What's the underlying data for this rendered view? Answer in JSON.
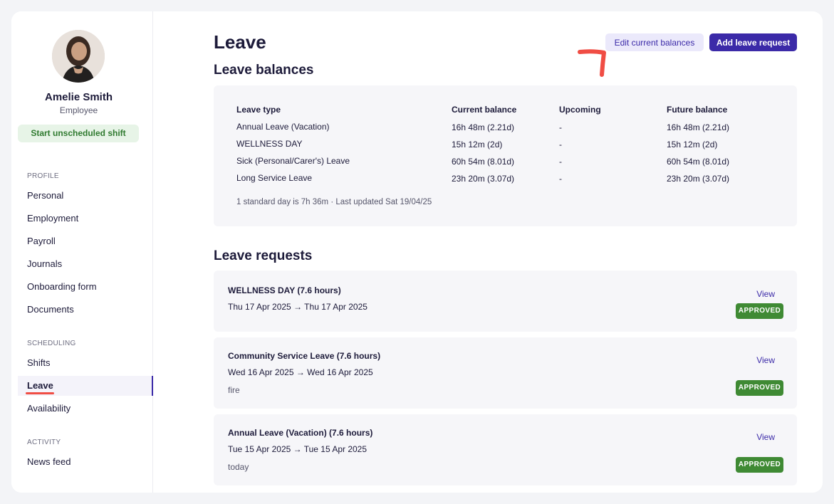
{
  "user": {
    "name": "Amelie Smith",
    "role": "Employee",
    "shift_button": "Start unscheduled shift"
  },
  "sidebar": {
    "sections": [
      {
        "label": "PROFILE",
        "items": [
          "Personal",
          "Employment",
          "Payroll",
          "Journals",
          "Onboarding form",
          "Documents"
        ]
      },
      {
        "label": "SCHEDULING",
        "items": [
          "Shifts",
          "Leave",
          "Availability"
        ]
      },
      {
        "label": "ACTIVITY",
        "items": [
          "News feed"
        ]
      }
    ],
    "active_item": "Leave"
  },
  "page": {
    "title": "Leave",
    "edit_button": "Edit current balances",
    "add_button": "Add leave request"
  },
  "balances": {
    "title": "Leave balances",
    "columns": [
      "Leave type",
      "Current balance",
      "Upcoming",
      "Future balance"
    ],
    "rows": [
      [
        "Annual Leave (Vacation)",
        "16h 48m (2.21d)",
        "-",
        "16h 48m (2.21d)"
      ],
      [
        "WELLNESS DAY",
        "15h 12m (2d)",
        "-",
        "15h 12m (2d)"
      ],
      [
        "Sick (Personal/Carer's) Leave",
        "60h 54m (8.01d)",
        "-",
        "60h 54m (8.01d)"
      ],
      [
        "Long Service Leave",
        "23h 20m (3.07d)",
        "-",
        "23h 20m (3.07d)"
      ]
    ],
    "footnote": "1 standard day is 7h 36m · Last updated Sat 19/04/25"
  },
  "requests": {
    "title": "Leave requests",
    "items": [
      {
        "title": "WELLNESS DAY (7.6 hours)",
        "dates": "Thu 17 Apr 2025 → Thu 17 Apr 2025",
        "note": "",
        "view": "View",
        "status": "APPROVED"
      },
      {
        "title": "Community Service Leave (7.6 hours)",
        "dates": "Wed 16 Apr 2025 → Wed 16 Apr 2025",
        "note": "fire",
        "view": "View",
        "status": "APPROVED"
      },
      {
        "title": "Annual Leave (Vacation) (7.6 hours)",
        "dates": "Tue 15 Apr 2025 → Tue 15 Apr 2025",
        "note": "today",
        "view": "View",
        "status": "APPROVED"
      }
    ]
  },
  "colors": {
    "accent": "#3b2aa8",
    "approved": "#3f8a34",
    "annotation": "#f04d44"
  }
}
